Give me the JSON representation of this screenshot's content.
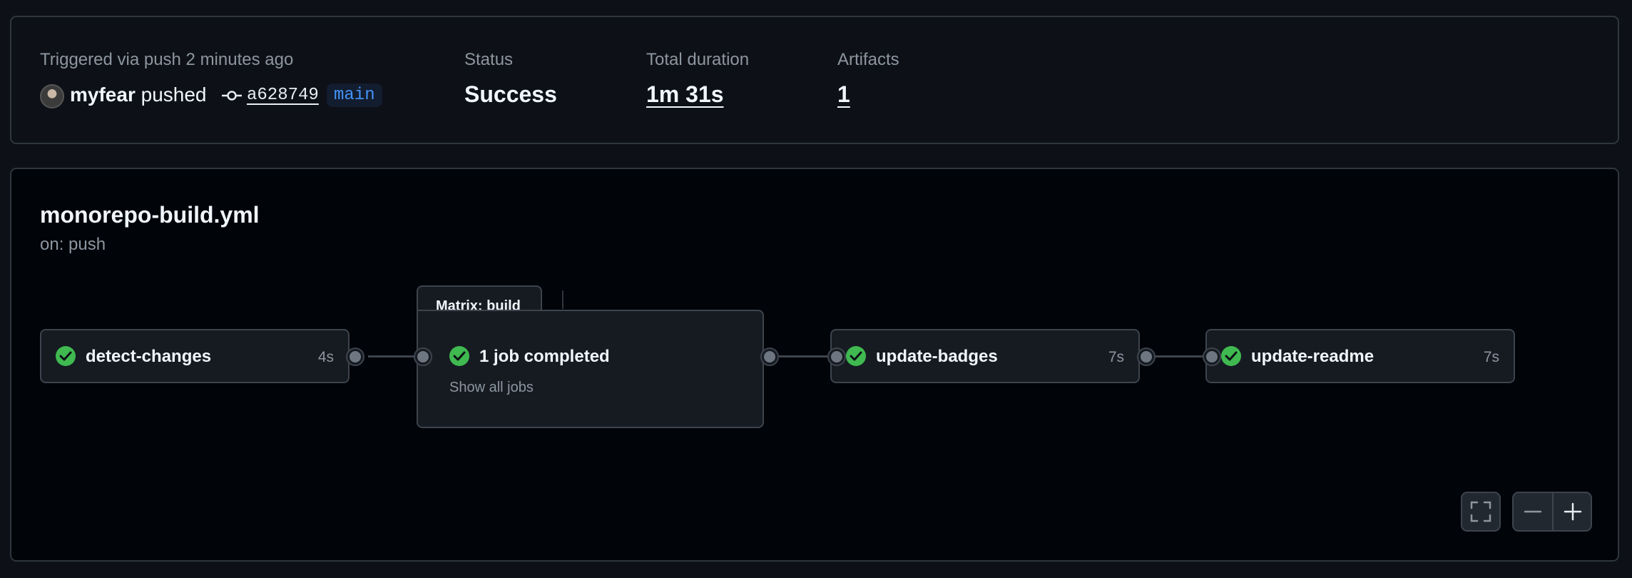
{
  "summary": {
    "trigger_text": "Triggered via push 2 minutes ago",
    "actor": "myfear",
    "action": "pushed",
    "commit_sha": "a628749",
    "branch": "main",
    "status_label": "Status",
    "status_value": "Success",
    "duration_label": "Total duration",
    "duration_value": "1m 31s",
    "artifacts_label": "Artifacts",
    "artifacts_value": "1"
  },
  "workflow": {
    "file_name": "monorepo-build.yml",
    "trigger": "on: push",
    "jobs": [
      {
        "name": "detect-changes",
        "duration": "4s",
        "status": "success"
      },
      {
        "name": "update-badges",
        "duration": "7s",
        "status": "success"
      },
      {
        "name": "update-readme",
        "duration": "7s",
        "status": "success"
      }
    ],
    "matrix": {
      "tab_label": "Matrix: build",
      "completed_text": "1 job completed",
      "show_all_link": "Show all jobs"
    }
  },
  "colors": {
    "success": "#3fb950",
    "background": "#0d1117",
    "canvas": "#010409",
    "branch": "#4493f8"
  },
  "icons": {
    "commit": "commit-icon",
    "check": "check-circle-icon",
    "fullscreen": "fullscreen-icon",
    "zoom_out": "minus-icon",
    "zoom_in": "plus-icon"
  }
}
